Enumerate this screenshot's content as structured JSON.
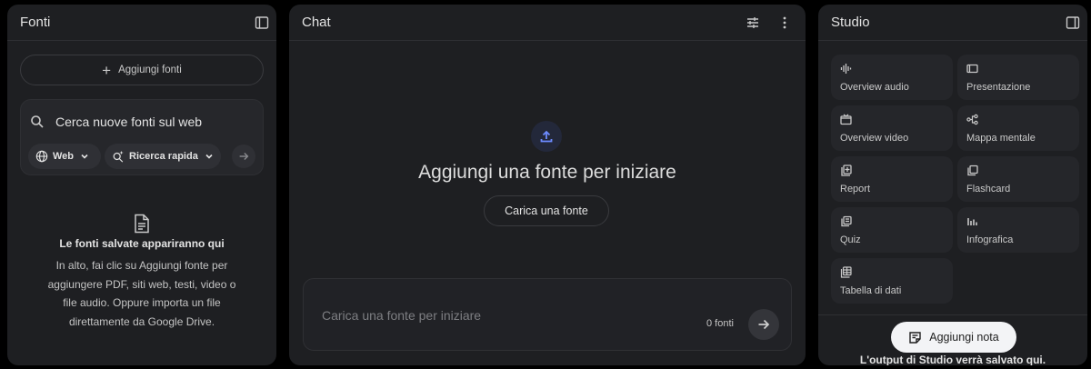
{
  "sources": {
    "title": "Fonti",
    "add_button": "Aggiungi fonti",
    "search": {
      "placeholder": "Cerca nuove fonti sul web",
      "web_chip": "Web",
      "rapid_chip": "Ricerca rapida"
    },
    "empty": {
      "title": "Le fonti salvate appariranno qui",
      "description": "In alto, fai clic su Aggiungi fonte per aggiungere PDF, siti web, testi, video o file audio. Oppure importa un file direttamente da Google Drive."
    }
  },
  "chat": {
    "title": "Chat",
    "heading": "Aggiungi una fonte per iniziare",
    "upload_button": "Carica una fonte",
    "input_placeholder": "Carica una fonte per iniziare",
    "source_count": "0 fonti"
  },
  "studio": {
    "title": "Studio",
    "tiles": [
      {
        "label": "Overview audio",
        "icon": "audio-wave-icon"
      },
      {
        "label": "Presentazione",
        "icon": "slides-icon"
      },
      {
        "label": "Overview video",
        "icon": "video-icon"
      },
      {
        "label": "Mappa mentale",
        "icon": "mind-map-icon"
      },
      {
        "label": "Report",
        "icon": "report-icon"
      },
      {
        "label": "Flashcard",
        "icon": "flashcard-icon"
      },
      {
        "label": "Quiz",
        "icon": "quiz-icon"
      },
      {
        "label": "Infografica",
        "icon": "infographic-icon"
      },
      {
        "label": "Tabella di dati",
        "icon": "data-table-icon"
      }
    ],
    "add_note": "Aggiungi nota",
    "footer": "L'output di Studio verrà salvato qui."
  },
  "colors": {
    "panel": "#1e1f22",
    "tile": "#25262a",
    "upload_accent": "#6d8bff"
  }
}
